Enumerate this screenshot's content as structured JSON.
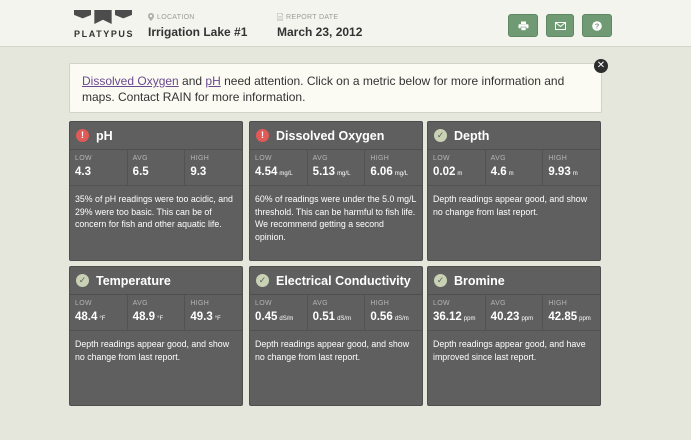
{
  "header": {
    "logo_text": "PLATYPUS",
    "location_label": "LOCATION",
    "location_value": "Irrigation Lake #1",
    "date_label": "REPORT DATE",
    "date_value": "March 23, 2012",
    "buttons": [
      {
        "icon": "print-icon"
      },
      {
        "icon": "mail-icon"
      },
      {
        "icon": "help-icon"
      }
    ]
  },
  "alert": {
    "link1": "Dissolved Oxygen",
    "text1": " and ",
    "link2": "pH",
    "text2": " need attention. Click on a metric below for more information and maps. Contact RAIN for more information.",
    "close_icon": "close-icon"
  },
  "stat_labels": {
    "low": "LOW",
    "avg": "AVG",
    "high": "HIGH"
  },
  "colors": {
    "background": "#e6e7dc",
    "card": "#5f5f5f",
    "button": "#6f9a73",
    "warning": "#e05a57",
    "ok": "#c9d2b4",
    "link": "#6a4a8e"
  },
  "metrics": [
    {
      "title": "pH",
      "status": "warning",
      "status_icon": "alert-icon",
      "low": "4.3",
      "avg": "6.5",
      "high": "9.3",
      "unit": "",
      "description": "35% of pH readings were too acidic, and 29% were too basic. This can be of concern for fish and other aquatic life."
    },
    {
      "title": "Dissolved Oxygen",
      "status": "warning",
      "status_icon": "alert-icon",
      "low": "4.54",
      "avg": "5.13",
      "high": "6.06",
      "unit": "mg/L",
      "description": "60% of readings were under the 5.0 mg/L threshold. This can be harmful to fish life. We recommend getting a second opinion."
    },
    {
      "title": "Depth",
      "status": "ok",
      "status_icon": "check-icon",
      "low": "0.02",
      "avg": "4.6",
      "high": "9.93",
      "unit": "m",
      "description": "Depth readings appear good, and show no change from last report."
    },
    {
      "title": "Temperature",
      "status": "ok",
      "status_icon": "check-icon",
      "low": "48.4",
      "avg": "48.9",
      "high": "49.3",
      "unit": "°F",
      "description": "Depth readings appear good, and show no change from last report."
    },
    {
      "title": "Electrical Conductivity",
      "status": "ok",
      "status_icon": "check-icon",
      "low": "0.45",
      "avg": "0.51",
      "high": "0.56",
      "unit": "dS/m",
      "description": "Depth readings appear good, and show no change from last report."
    },
    {
      "title": "Bromine",
      "status": "ok",
      "status_icon": "check-icon",
      "low": "36.12",
      "avg": "40.23",
      "high": "42.85",
      "unit": "ppm",
      "description": "Depth readings appear good, and have improved since last report."
    }
  ]
}
